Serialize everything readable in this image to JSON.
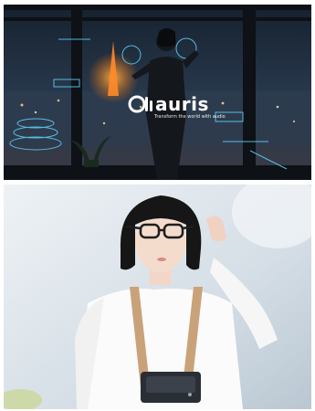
{
  "brand": {
    "name": "auris",
    "tagline": "Transform the world with audio"
  }
}
